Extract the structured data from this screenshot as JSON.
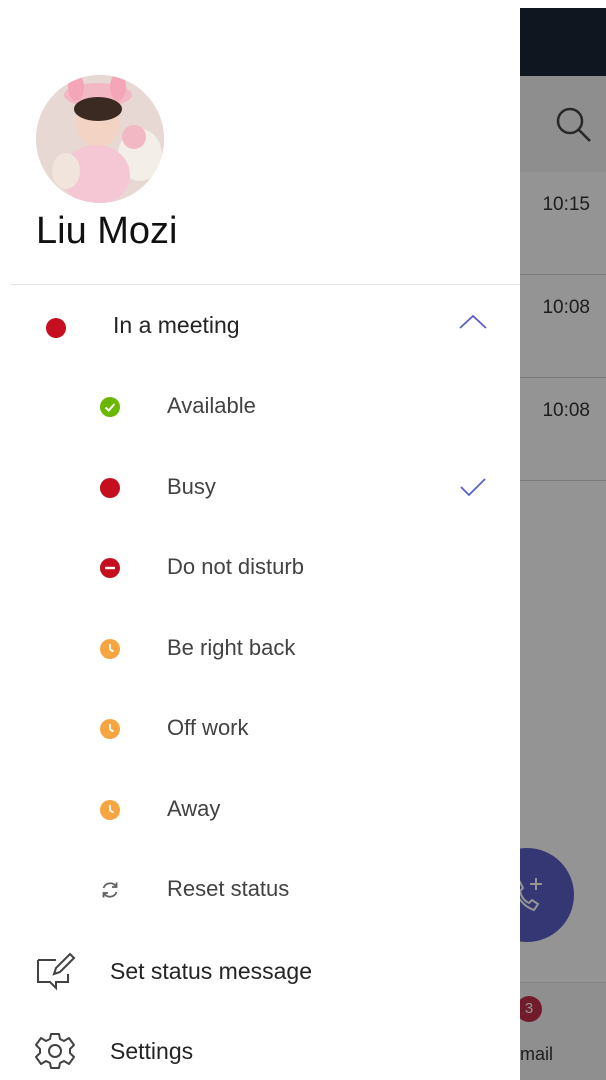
{
  "background": {
    "times": [
      "10:15",
      "10:08",
      "10:08"
    ],
    "mail_badge": "3",
    "mail_label": "mail"
  },
  "profile": {
    "name": "Liu Mozi"
  },
  "current_status": {
    "label": "In a meeting",
    "color": "#c50f1f"
  },
  "statuses": [
    {
      "label": "Available",
      "icon": "available-icon",
      "color": "#6bb700"
    },
    {
      "label": "Busy",
      "icon": "busy-icon",
      "color": "#c50f1f",
      "selected": true
    },
    {
      "label": "Do not disturb",
      "icon": "do-not-disturb-icon",
      "color": "#c50f1f"
    },
    {
      "label": "Be right back",
      "icon": "be-right-back-icon",
      "color": "#f7a541"
    },
    {
      "label": "Off work",
      "icon": "off-work-icon",
      "color": "#f7a541"
    },
    {
      "label": "Away",
      "icon": "away-icon",
      "color": "#f7a541"
    },
    {
      "label": "Reset status",
      "icon": "reset-icon",
      "color": "#616161"
    }
  ],
  "menu": {
    "set_status_message": "Set status message",
    "settings": "Settings"
  },
  "colors": {
    "accent": "#5b5fc7",
    "topbar": "#1a2738"
  }
}
